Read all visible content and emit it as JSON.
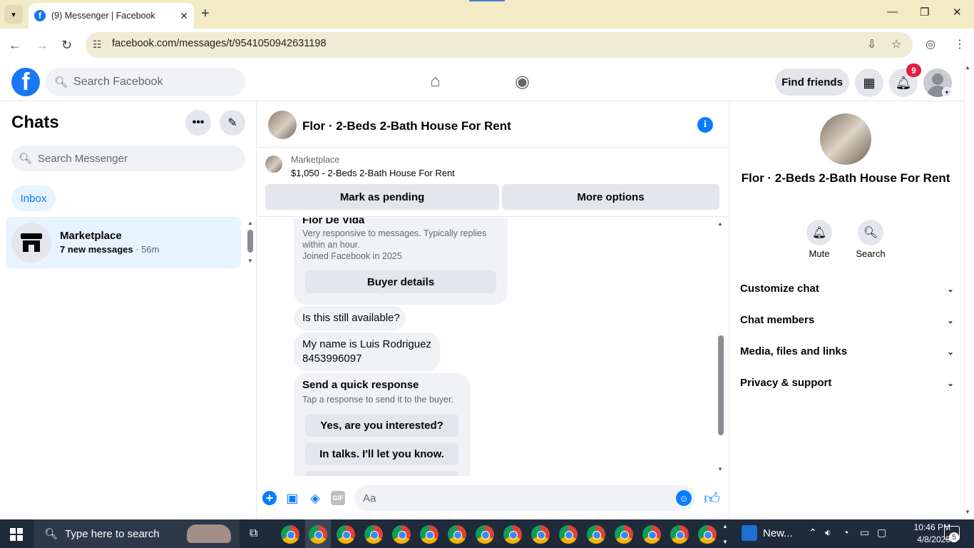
{
  "browser": {
    "tab_title": "(9) Messenger | Facebook",
    "url": "facebook.com/messages/t/9541050942631198"
  },
  "fb_header": {
    "search_placeholder": "Search Facebook",
    "find_friends_label": "Find friends",
    "notification_count": "9"
  },
  "left_panel": {
    "title": "Chats",
    "search_placeholder": "Search Messenger",
    "inbox_label": "Inbox",
    "conversations": [
      {
        "name": "Marketplace",
        "unread": "7 new messages",
        "time": "· 56m"
      }
    ]
  },
  "chat": {
    "title": "Flor · 2-Beds 2-Bath House For Rent",
    "marketplace_label": "Marketplace",
    "listing": "$1,050 - 2-Beds 2-Bath House For Rent",
    "mark_pending_label": "Mark as pending",
    "more_options_label": "More options",
    "seller_card": {
      "name": "Flor De Vida",
      "line1": "Very responsive to messages. Typically replies within an hour.",
      "line2": "Joined Facebook in 2025",
      "button_label": "Buyer details"
    },
    "messages": [
      "Is this still available?",
      "My name is Luis Rodriguez",
      "8453996097"
    ],
    "quick_response": {
      "title": "Send a quick response",
      "subtitle": "Tap a response to send it to the buyer.",
      "options": [
        "Yes, are you interested?",
        "In talks. I'll let you know."
      ]
    },
    "composer_placeholder": "Aa",
    "gif_label": "GIF"
  },
  "right_panel": {
    "title": "Flor · 2-Beds 2-Bath House For Rent",
    "actions": [
      {
        "label": "Mute",
        "icon": "bell-icon"
      },
      {
        "label": "Search",
        "icon": "search-icon"
      }
    ],
    "sections": [
      "Customize chat",
      "Chat members",
      "Media, files and links",
      "Privacy & support"
    ]
  },
  "taskbar": {
    "search_placeholder": "Type here to search",
    "news_label": "New...",
    "time": "10:46 PM",
    "date": "4/8/2025",
    "notification_count": "5"
  },
  "colors": {
    "fb_blue": "#1877f2",
    "messenger_blue": "#0a7cff",
    "badge_red": "#e41e3f",
    "tab_strip": "#f2ebc6"
  }
}
